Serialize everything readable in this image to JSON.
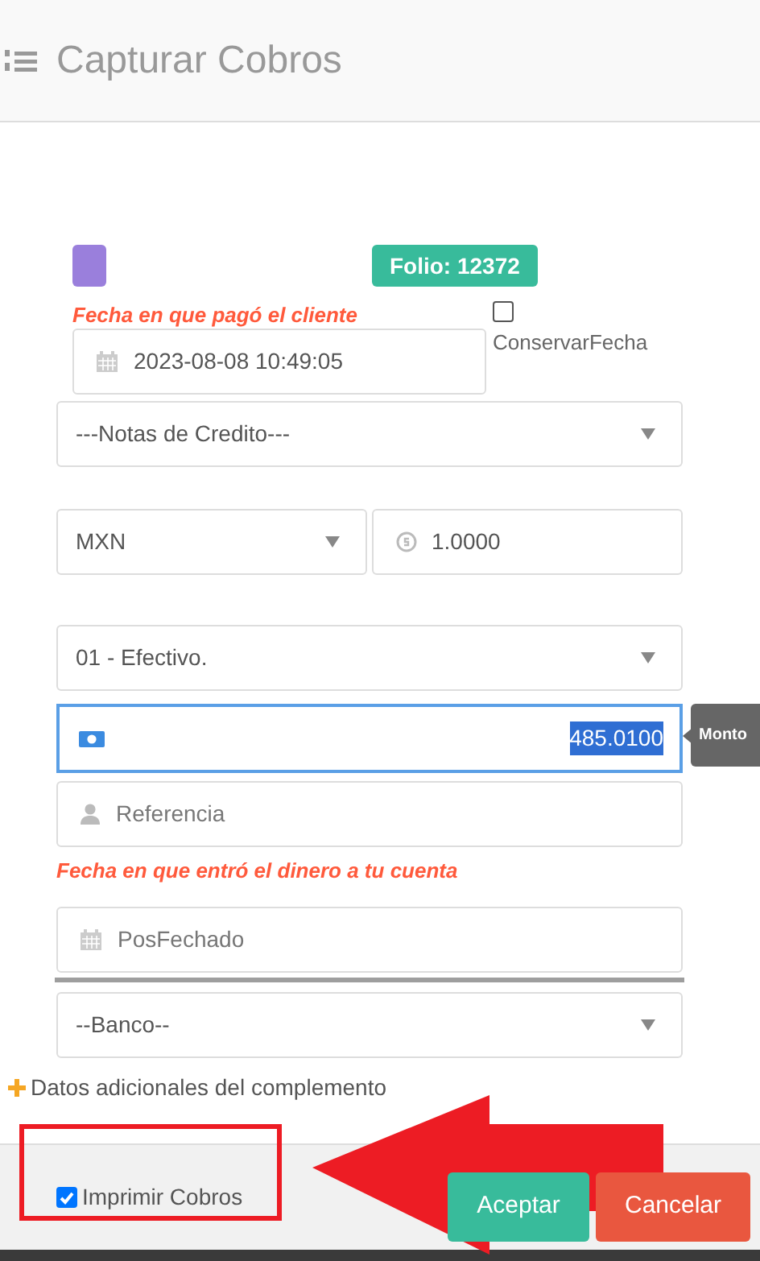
{
  "header": {
    "title": "Capturar Cobros"
  },
  "folio": "Folio: 12372",
  "payment_date": {
    "label": "Fecha en que pagó el cliente",
    "value": "2023-08-08 10:49:05"
  },
  "keep_date": {
    "label": "ConservarFecha",
    "checked": false
  },
  "credit_notes": {
    "value": "---Notas de Credito---"
  },
  "currency": {
    "value": "MXN"
  },
  "exchange_rate": {
    "value": "1.0000"
  },
  "payment_method": {
    "value": "01 - Efectivo."
  },
  "amount": {
    "value": "485.0100",
    "tooltip": "Monto"
  },
  "reference": {
    "placeholder": "Referencia"
  },
  "deposit_date": {
    "label": "Fecha en que entró el dinero a tu cuenta",
    "placeholder": "PosFechado"
  },
  "bank": {
    "value": "--Banco--"
  },
  "extra_data": {
    "label": "Datos adicionales del complemento"
  },
  "print": {
    "label": "Imprimir Cobros",
    "checked": true
  },
  "buttons": [
    {
      "label": "Aceptar",
      "kind": "primary"
    },
    {
      "label": "Cancelar",
      "kind": "danger"
    }
  ]
}
